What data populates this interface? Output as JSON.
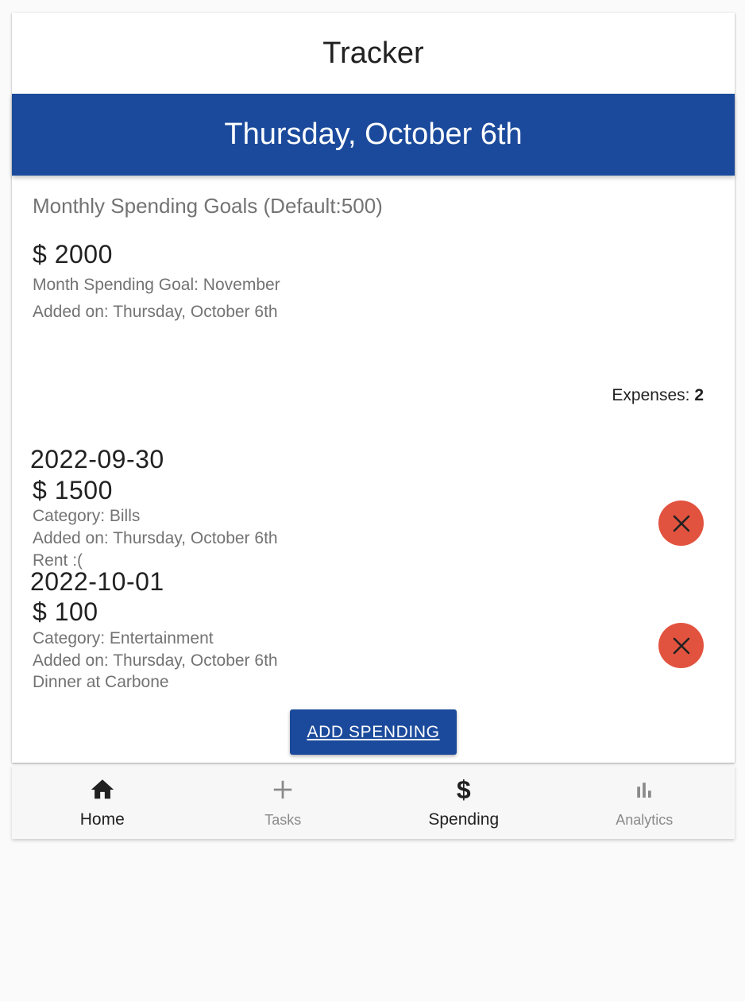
{
  "header": {
    "title": "Tracker",
    "date_banner": "Thursday, October 6th"
  },
  "goals": {
    "heading": "Monthly Spending Goals (Default:500)",
    "amount": "$ 2000",
    "month_line": "Month Spending Goal: November",
    "added_line": "Added on: Thursday, October 6th"
  },
  "expenses": {
    "label": "Expenses: ",
    "count": "2",
    "items": [
      {
        "date": "2022-09-30",
        "amount": "$ 1500",
        "category": "Category: Bills",
        "added": "Added on: Thursday, October 6th",
        "note": "Rent :("
      },
      {
        "date": "2022-10-01",
        "amount": "$ 100",
        "category": "Category: Entertainment",
        "added": "Added on: Thursday, October 6th",
        "note": "Dinner at Carbone"
      }
    ]
  },
  "actions": {
    "add_spending": "ADD SPENDING"
  },
  "nav": {
    "items": [
      {
        "label": "Home",
        "icon": "home-icon"
      },
      {
        "label": "Tasks",
        "icon": "plus-icon"
      },
      {
        "label": "Spending",
        "icon": "dollar-icon",
        "glyph": "$"
      },
      {
        "label": "Analytics",
        "icon": "bar-chart-icon"
      }
    ]
  },
  "colors": {
    "primary": "#1b4a9c",
    "delete": "#e2533f",
    "muted_text": "#737373"
  }
}
